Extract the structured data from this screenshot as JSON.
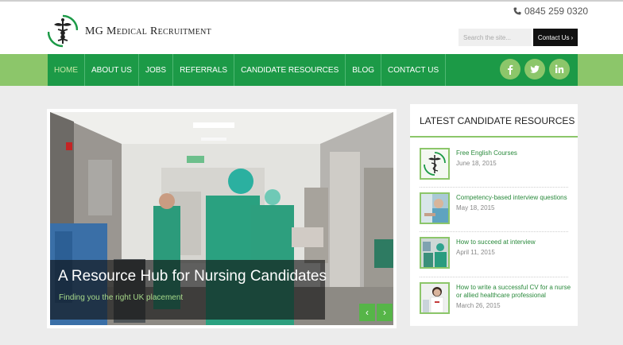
{
  "header": {
    "brand": "MG Medical Recruitment",
    "phone": "0845 259 0320",
    "search_placeholder": "Search the site...",
    "contact_label": "Contact Us",
    "contact_chevron": "›"
  },
  "nav": {
    "items": [
      {
        "label": "HOME",
        "active": true
      },
      {
        "label": "ABOUT US"
      },
      {
        "label": "JOBS"
      },
      {
        "label": "REFERRALS"
      },
      {
        "label": "CANDIDATE RESOURCES"
      },
      {
        "label": "BLOG"
      },
      {
        "label": "CONTACT US"
      }
    ],
    "social": [
      "facebook-icon",
      "twitter-icon",
      "linkedin-icon"
    ]
  },
  "slider": {
    "title": "A Resource Hub for Nursing Candidates",
    "subtitle": "Finding you the right UK placement",
    "prev": "‹",
    "next": "›"
  },
  "sidebar": {
    "title": "LATEST CANDIDATE RESOURCES",
    "posts": [
      {
        "title": "Free English Courses",
        "date": "June 18, 2015"
      },
      {
        "title": "Competency-based interview questions",
        "date": "May 18, 2015"
      },
      {
        "title": "How to succeed at interview",
        "date": "April 11, 2015"
      },
      {
        "title": "How to write a successful CV for a nurse or allied healthcare professional",
        "date": "March 26, 2015"
      }
    ]
  },
  "colors": {
    "nav_green": "#1c9a47",
    "light_green": "#8cc66a",
    "link_green": "#2a8a3c"
  }
}
